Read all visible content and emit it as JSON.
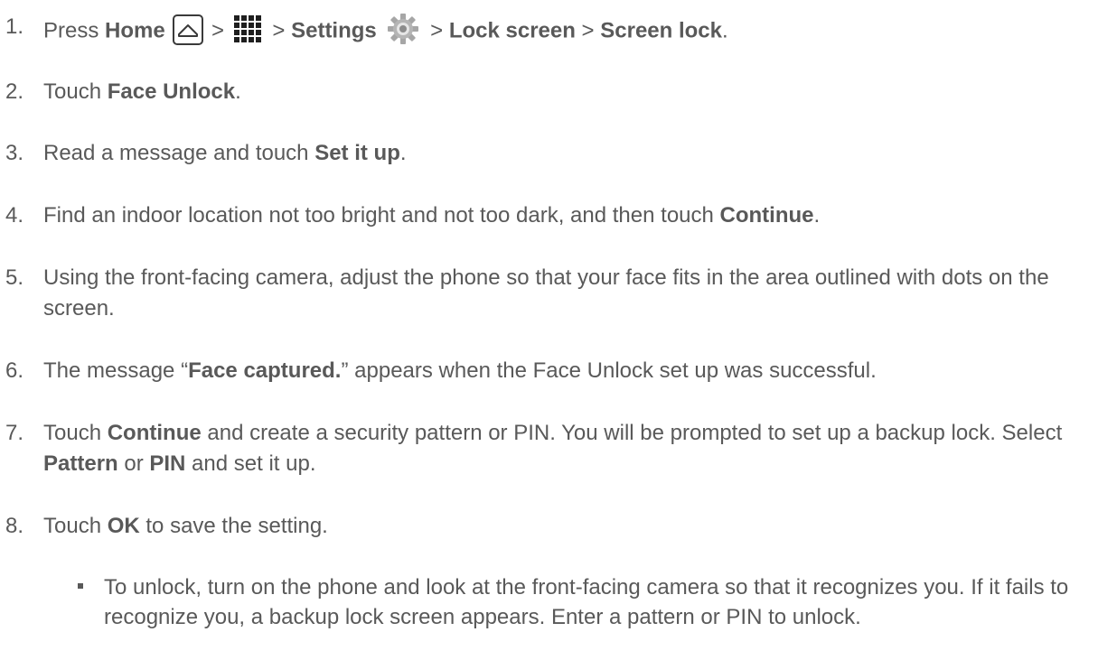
{
  "steps": [
    {
      "number": "1.",
      "parts": {
        "p0": "Press ",
        "home": "Home",
        "sep1": " > ",
        "sep2": " > ",
        "settings": "Settings",
        "sep3": " > ",
        "lock_screen": "Lock screen",
        "sep4": " > ",
        "screen_lock": "Screen lock",
        "end": "."
      },
      "icons": [
        "home-icon",
        "apps-icon",
        "gear-icon"
      ]
    },
    {
      "number": "2.",
      "parts": {
        "p0": "Touch ",
        "b1": "Face Unlock",
        "end": "."
      }
    },
    {
      "number": "3.",
      "parts": {
        "p0": "Read a message and touch ",
        "b1": "Set it up",
        "end": "."
      }
    },
    {
      "number": "4.",
      "parts": {
        "p0": "Find an indoor location not too bright and not too dark, and then touch ",
        "b1": "Continue",
        "end": "."
      }
    },
    {
      "number": "5.",
      "text": "Using the front-facing camera, adjust the phone so that your face fits in the area outlined with dots on the screen."
    },
    {
      "number": "6.",
      "parts": {
        "p0": "The message “",
        "b1": "Face captured.",
        "p2": "” appears when the Face Unlock set up was successful."
      }
    },
    {
      "number": "7.",
      "parts": {
        "p0": "Touch ",
        "b1": "Continue",
        "p2": " and create a security pattern or PIN. You will be prompted to set up a backup lock. Select ",
        "b3": "Pattern",
        "p4": " or ",
        "b5": "PIN",
        "p6": " and set it up."
      }
    },
    {
      "number": "8.",
      "parts": {
        "p0": "Touch ",
        "b1": "OK",
        "p2": " to save the setting."
      }
    }
  ],
  "sub_bullet": {
    "text": "To unlock, turn on the phone and look at the front-facing camera so that it recognizes you. If it fails to recognize you, a backup lock screen appears. Enter a pattern or PIN to unlock."
  },
  "colors": {
    "text": "#595959",
    "icon": "#1f1f1f",
    "gear": "#9e9e9e"
  }
}
